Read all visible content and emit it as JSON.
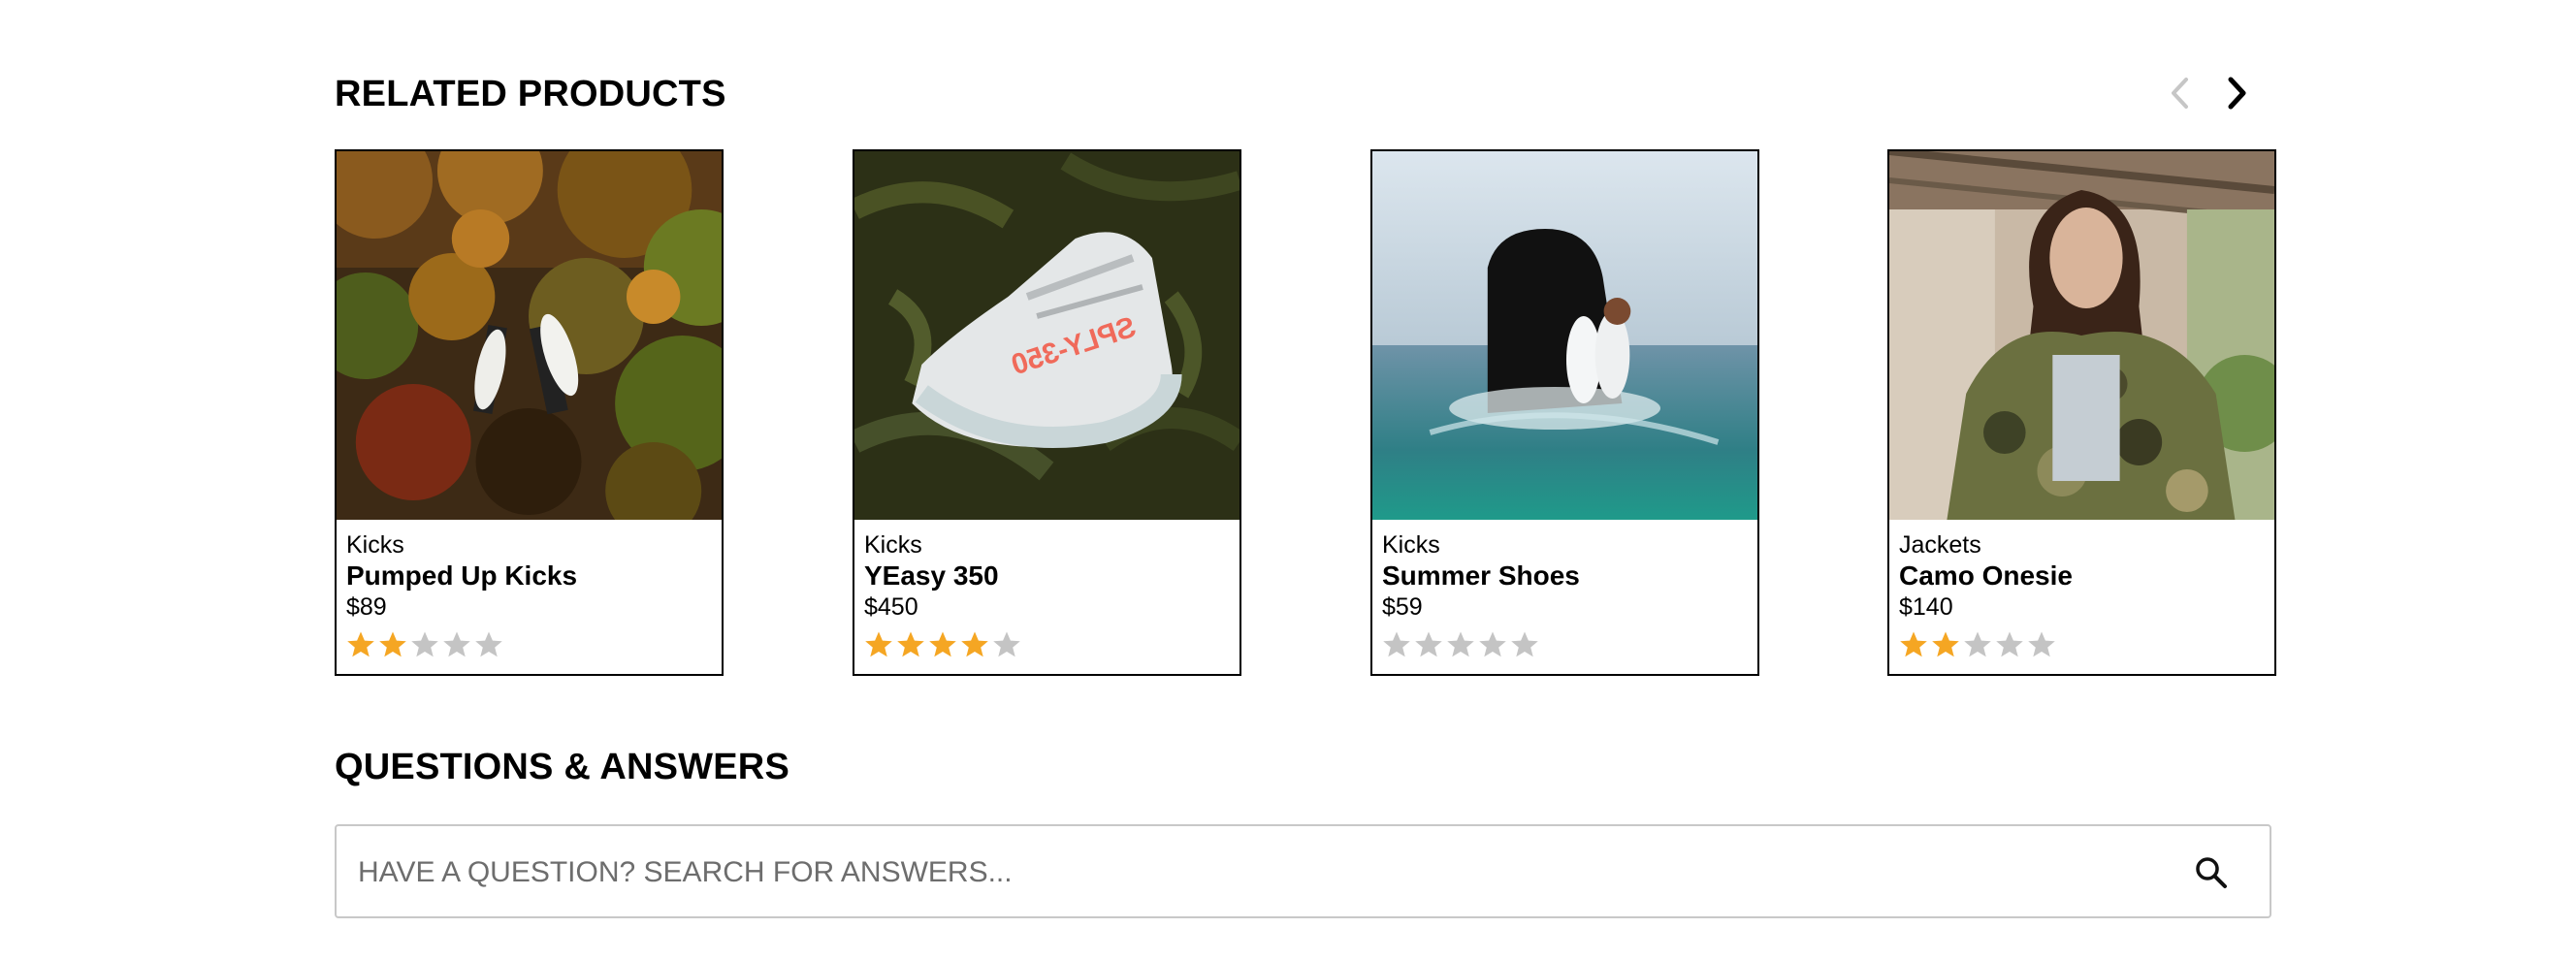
{
  "related_products": {
    "title": "RELATED PRODUCTS",
    "prev_icon": "chevron-left-icon",
    "next_icon": "chevron-right-icon",
    "items": [
      {
        "category": "Kicks",
        "name": "Pumped Up Kicks",
        "price": "$89",
        "rating": 2,
        "max_rating": 5
      },
      {
        "category": "Kicks",
        "name": "YEasy 350",
        "price": "$450",
        "rating": 4,
        "max_rating": 5
      },
      {
        "category": "Kicks",
        "name": "Summer Shoes",
        "price": "$59",
        "rating": 0,
        "max_rating": 5
      },
      {
        "category": "Jackets",
        "name": "Camo Onesie",
        "price": "$140",
        "rating": 2,
        "max_rating": 5
      }
    ]
  },
  "questions": {
    "title": "QUESTIONS & ANSWERS",
    "search_placeholder": "HAVE A QUESTION? SEARCH FOR ANSWERS...",
    "search_value": "",
    "search_icon": "magnifier-icon"
  },
  "colors": {
    "star_filled": "#f5a623",
    "star_empty": "#c4c4c4",
    "prev_arrow": "#c6c6c6",
    "next_arrow": "#000000",
    "search_border": "#c8c8c8"
  }
}
